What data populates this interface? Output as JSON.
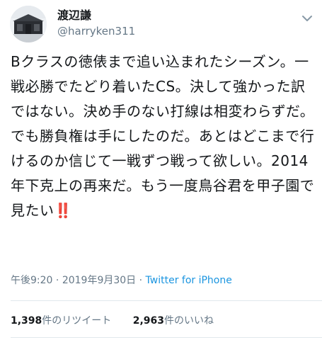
{
  "profile": {
    "display_name": "渡辺謙",
    "handle": "@harryken311"
  },
  "tweet": {
    "text": "Bクラスの徳俵まで追い込まれたシーズン。一戦必勝でたどり着いたCS。決して強かった訳ではない。決め手のない打線は相変わらずだ。でも勝負権は手にしたのだ。あとはどこまで行けるのか信じて一戦ずつ戦って欲しい。2014年下克上の再来だ。もう一度鳥谷君を甲子園で見たい",
    "emoji": "‼️",
    "time": "午後9:20",
    "separator": "·",
    "date": "2019年9月30日",
    "source": "Twitter for iPhone"
  },
  "stats": {
    "retweets_count": "1,398",
    "retweets_label": "件のリツイート",
    "likes_count": "2,963",
    "likes_label": "件のいいね"
  },
  "icons": {
    "menu": "chevron-down-icon",
    "avatar": "avatar"
  },
  "colors": {
    "text": "#14171a",
    "secondary": "#657786",
    "link": "#1b95e0",
    "divider": "#e1e8ed",
    "emoji": "#cc1f26"
  }
}
